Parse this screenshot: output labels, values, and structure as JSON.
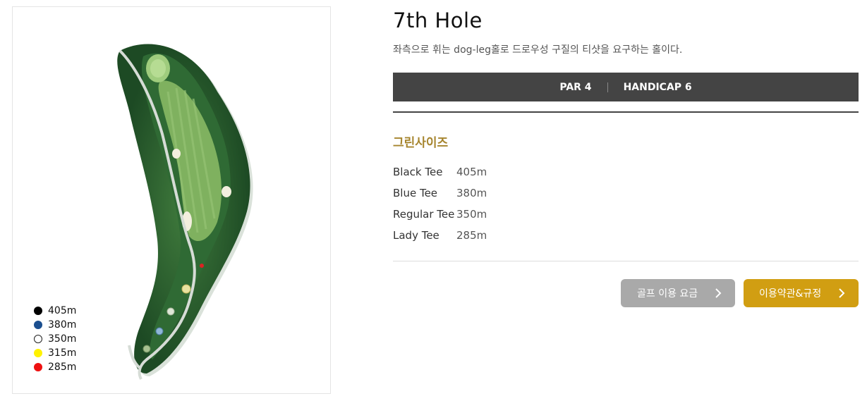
{
  "hole": {
    "title": "7th Hole",
    "description": "좌측으로 휘는 dog-leg홀로 드로우성 구질의 티샷을 요구하는 홀이다.",
    "par": "PAR 4",
    "handicap": "HANDICAP 6"
  },
  "green_size": {
    "title": "그린사이즈"
  },
  "tees": [
    {
      "name": "Black Tee",
      "distance": "405m"
    },
    {
      "name": "Blue Tee",
      "distance": "380m"
    },
    {
      "name": "Regular Tee",
      "distance": "350m"
    },
    {
      "name": "Lady Tee",
      "distance": "285m"
    }
  ],
  "legend": [
    {
      "distance": "405m",
      "color": "#000000"
    },
    {
      "distance": "380m",
      "color": "#1b4f8f"
    },
    {
      "distance": "350m",
      "color": "#ffffff"
    },
    {
      "distance": "315m",
      "color": "#fff200"
    },
    {
      "distance": "285m",
      "color": "#ee1111"
    }
  ],
  "buttons": {
    "fee": {
      "label": "골프 이용 요금",
      "icon": "chevron-right-icon"
    },
    "terms": {
      "label": "이용약관&규정",
      "icon": "chevron-right-icon"
    }
  },
  "colors": {
    "fee_button": "#a9a9a9",
    "terms_button": "#d19e12",
    "accent_gold": "#a6852e",
    "par_bar": "#444444"
  }
}
